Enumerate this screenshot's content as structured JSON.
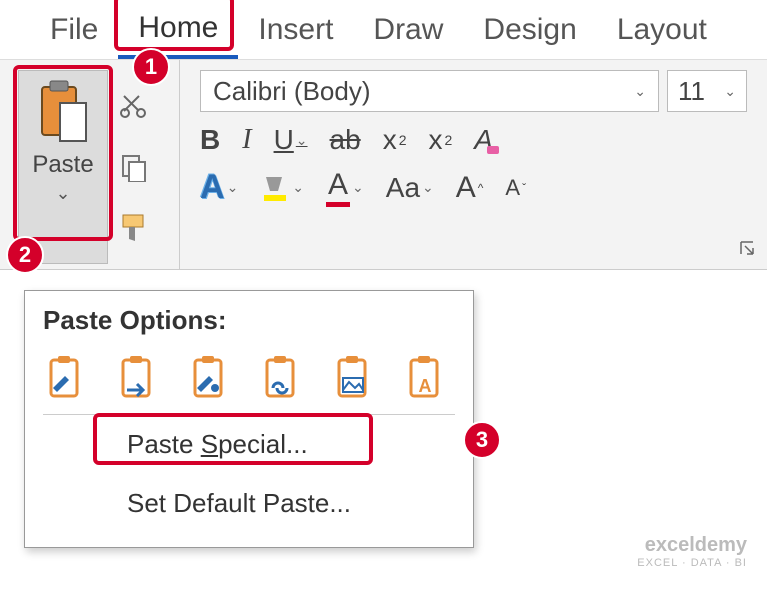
{
  "tabs": {
    "file": "File",
    "home": "Home",
    "insert": "Insert",
    "draw": "Draw",
    "design": "Design",
    "layout": "Layout"
  },
  "clipboard": {
    "paste": "Paste"
  },
  "font": {
    "family": "Calibri (Body)",
    "size": "11",
    "bold": "B",
    "italic": "I",
    "underline": "U",
    "strike": "ab",
    "subscript": "x",
    "subscript_sub": "2",
    "superscript": "x",
    "superscript_sup": "2",
    "text_effects": "A",
    "highlight": "",
    "font_color": "A",
    "change_case": "Aa",
    "grow": "A",
    "shrink": "A",
    "clear": "A"
  },
  "popup": {
    "title": "Paste Options:",
    "paste_special_pre": "Paste ",
    "paste_special_ul": "S",
    "paste_special_post": "pecial...",
    "set_default": "Set Default Paste..."
  },
  "badges": {
    "b1": "1",
    "b2": "2",
    "b3": "3"
  },
  "watermark": {
    "line1": "exceldemy",
    "line2": "EXCEL · DATA · BI"
  }
}
